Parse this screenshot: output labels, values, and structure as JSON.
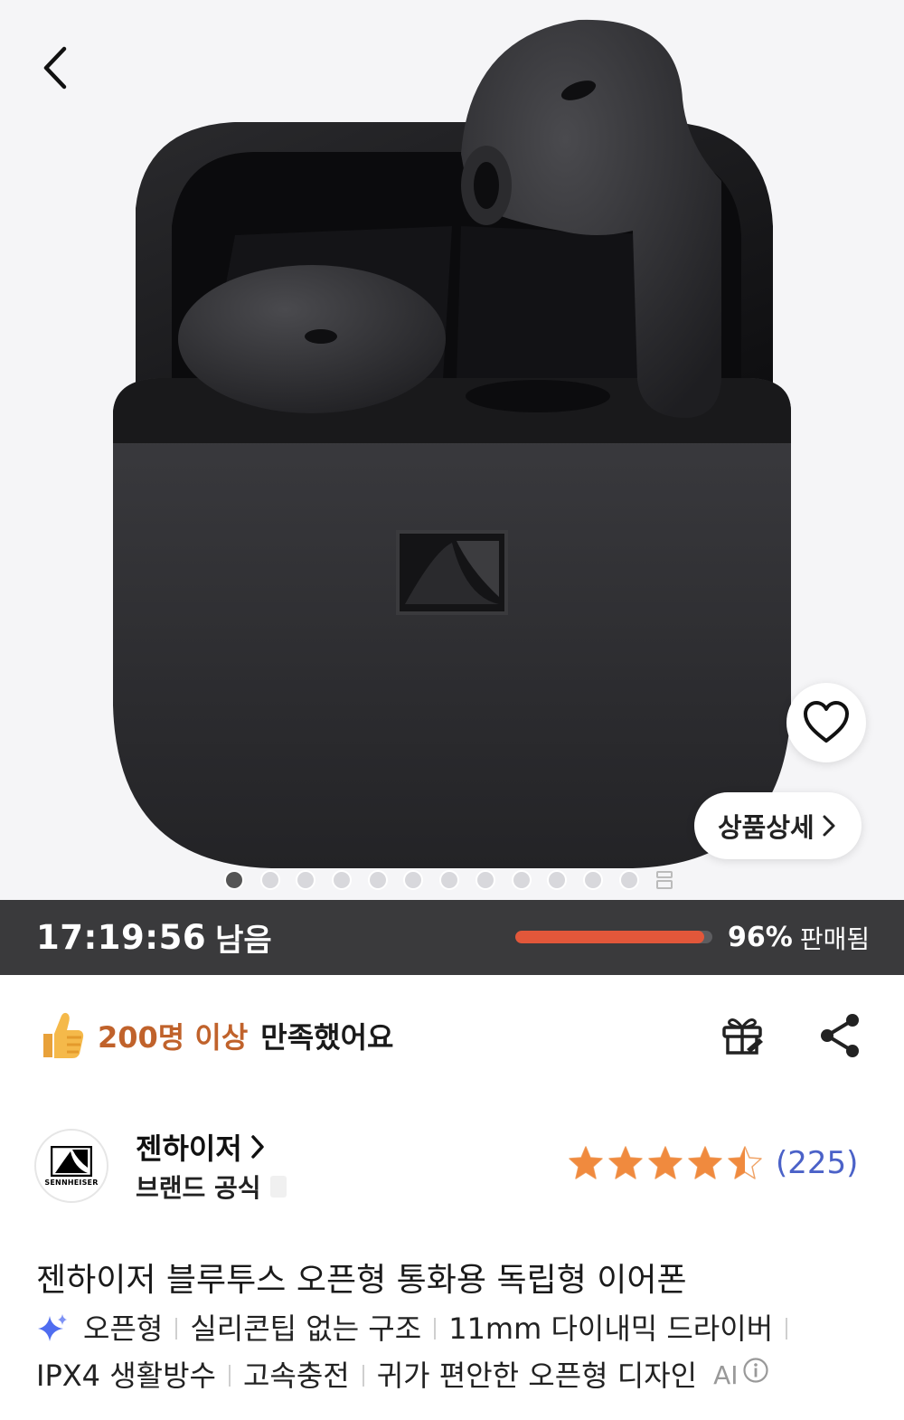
{
  "hero": {
    "slides_total": 12,
    "active_slide": 1,
    "detail_button_label": "상품상세"
  },
  "deal": {
    "time_remaining": "17:19:56",
    "time_suffix": "남음",
    "sold_percent": "96%",
    "sold_fraction": 0.96,
    "sold_label": "판매됨",
    "accent_color": "#e2573a"
  },
  "satisfaction": {
    "count_text": "200명 이상",
    "text": "만족했어요"
  },
  "brand": {
    "logo_text": "SENNHEISER",
    "name": "젠하이저",
    "official_label": "브랜드 공식"
  },
  "rating": {
    "score_stars": 4.5,
    "review_count": "(225)"
  },
  "product": {
    "title": "젠하이저 블루투스 오픈형 통화용 독립형 이어폰",
    "features_line1": [
      "오픈형",
      "실리콘팁 없는 구조",
      "11mm 다이내믹 드라이버"
    ],
    "features_line2": [
      "IPX4 생활방수",
      "고속충전",
      "귀가 편안한 오픈형 디자인"
    ],
    "ai_label": "AI"
  },
  "icons": {
    "back": "chevron-left-icon",
    "wishlist": "heart-icon",
    "detail": "chevron-right-icon",
    "gift": "gift-icon",
    "share": "share-icon",
    "thumbs": "thumbs-up-icon",
    "sparkle": "sparkle-icon",
    "info": "info-icon"
  }
}
